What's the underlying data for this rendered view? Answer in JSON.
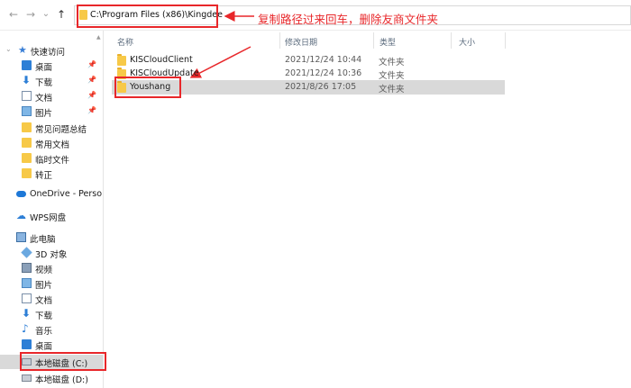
{
  "nav": {
    "back_icon": "←",
    "forward_icon": "→",
    "dropdown_icon": "⌄",
    "up_icon": "↑"
  },
  "address": {
    "path": "C:\\Program Files (x86)\\Kingdee"
  },
  "annotations": {
    "instruction": "复制路径过来回车，删除友商文件夹",
    "arrow_color": "#e8272a"
  },
  "columns": {
    "name": "名称",
    "date": "修改日期",
    "type": "类型",
    "size": "大小"
  },
  "files": [
    {
      "name": "KISCloudClient",
      "date": "2021/12/24 10:44",
      "type": "文件夹"
    },
    {
      "name": "KISCloudUpdate",
      "date": "2021/12/24 10:36",
      "type": "文件夹"
    },
    {
      "name": "Youshang",
      "date": "2021/8/26 17:05",
      "type": "文件夹"
    }
  ],
  "sidebar": {
    "quick_access": "快速访问",
    "quick_items": [
      {
        "label": "桌面"
      },
      {
        "label": "下载"
      },
      {
        "label": "文档"
      },
      {
        "label": "图片"
      },
      {
        "label": "常见问题总结"
      },
      {
        "label": "常用文档"
      },
      {
        "label": "临时文件"
      },
      {
        "label": "转正"
      }
    ],
    "onedrive": "OneDrive - Perso",
    "wps": "WPS网盘",
    "this_pc": "此电脑",
    "pc_items": [
      {
        "label": "3D 对象"
      },
      {
        "label": "视频"
      },
      {
        "label": "图片"
      },
      {
        "label": "文档"
      },
      {
        "label": "下载"
      },
      {
        "label": "音乐"
      },
      {
        "label": "桌面"
      },
      {
        "label": "本地磁盘 (C:)"
      },
      {
        "label": "本地磁盘 (D:)"
      }
    ]
  },
  "colors": {
    "highlight_red": "#e8272a",
    "selection_gray": "#d9d9d9",
    "folder_yellow": "#f7c948",
    "accent_blue": "#2d7fd6"
  }
}
